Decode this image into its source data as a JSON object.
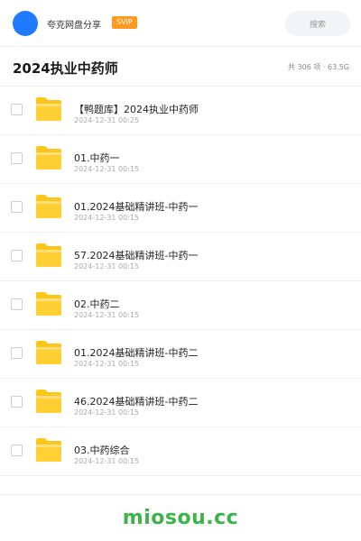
{
  "header": {
    "username": "夸克网盘分享",
    "badge": "SVIP",
    "search_label": "搜索"
  },
  "folder": {
    "title": "2024执业中药师",
    "summary": "共 306 项 · 63.5G"
  },
  "files": [
    {
      "name": "【鸭题库】2024执业中药师",
      "date": "2024-12-31 00:25",
      "icon": "folder-icon"
    },
    {
      "name": "01.中药一",
      "date": "2024-12-31 00:15",
      "icon": "folder-icon"
    },
    {
      "name": "01.2024基础精讲班-中药一",
      "date": "2024-12-31 00:15",
      "icon": "folder-icon"
    },
    {
      "name": "57.2024基础精讲班-中药一",
      "date": "2024-12-31 00:15",
      "icon": "folder-icon"
    },
    {
      "name": "02.中药二",
      "date": "2024-12-31 00:15",
      "icon": "folder-icon"
    },
    {
      "name": "01.2024基础精讲班-中药二",
      "date": "2024-12-31 00:15",
      "icon": "folder-icon"
    },
    {
      "name": "46.2024基础精讲班-中药二",
      "date": "2024-12-31 00:15",
      "icon": "folder-icon"
    },
    {
      "name": "03.中药综合",
      "date": "2024-12-31 00:15",
      "icon": "folder-icon"
    }
  ],
  "footer": {
    "watermark": "miosou.cc"
  },
  "colors": {
    "accent": "#1e7bff",
    "svip": "#ff9a1f",
    "folder": "#ffc61a",
    "watermark": "#3bb54a"
  }
}
